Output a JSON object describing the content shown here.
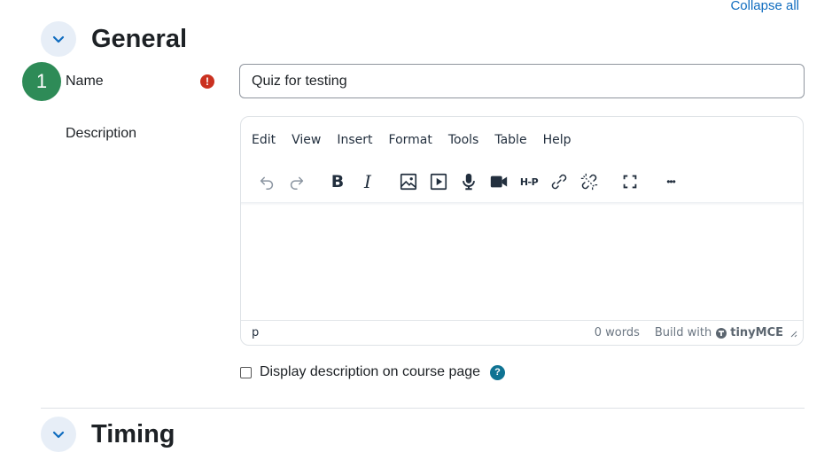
{
  "header": {
    "collapse_all_label": "Collapse all"
  },
  "sections": [
    {
      "title": "General",
      "expanded": true
    },
    {
      "title": "Timing",
      "expanded": false
    }
  ],
  "step_badge": "1",
  "name_field": {
    "label": "Name",
    "value": "Quiz for testing",
    "required_icon": "!"
  },
  "description_field": {
    "label": "Description",
    "menu": [
      "Edit",
      "View",
      "Insert",
      "Format",
      "Tools",
      "Table",
      "Help"
    ],
    "toolbar_icons": [
      "undo-icon",
      "redo-icon",
      "bold-icon",
      "italic-icon",
      "image-icon",
      "media-icon",
      "microphone-icon",
      "video-icon",
      "h5p-icon",
      "link-icon",
      "unlink-icon",
      "fullscreen-icon",
      "more-icon"
    ],
    "bold_glyph": "B",
    "italic_glyph": "I",
    "h5p_glyph": "H-P",
    "more_glyph": "•••",
    "status_path": "p",
    "word_count": "0 words",
    "build_with": "Build with",
    "brand": "tinyMCE"
  },
  "display_description": {
    "label": "Display description on course page",
    "checked": false,
    "help_icon": "?"
  },
  "colors": {
    "accent": "#0f6cbf",
    "required": "#ca3120",
    "badge": "#2e8b57",
    "help": "#0f7393"
  }
}
